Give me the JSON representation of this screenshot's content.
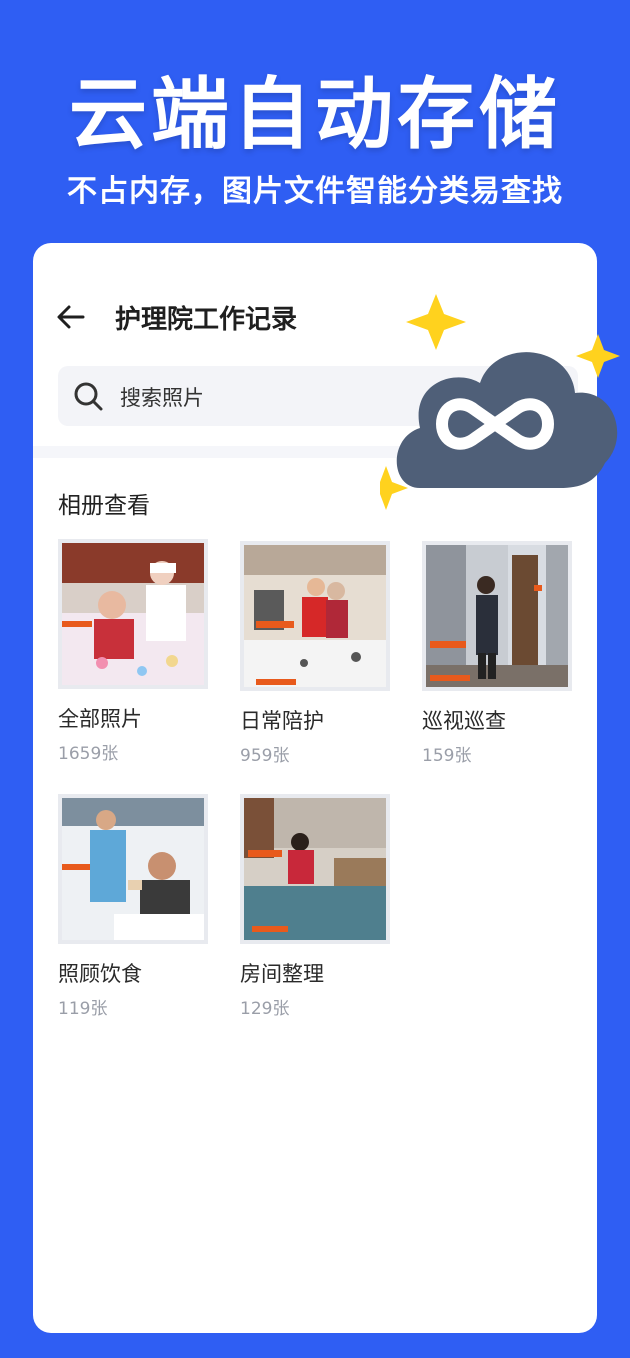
{
  "hero": {
    "title": "云端自动存储",
    "subtitle": "不占内存，图片文件智能分类易查找"
  },
  "header": {
    "back_icon": "arrow-left-icon",
    "title": "护理院工作记录"
  },
  "search": {
    "icon": "search-icon",
    "placeholder": "搜索照片"
  },
  "section": {
    "title": "相册查看"
  },
  "albums": [
    {
      "name": "全部照片",
      "count": "1659张"
    },
    {
      "name": "日常陪护",
      "count": "959张"
    },
    {
      "name": "巡视巡查",
      "count": "159张"
    },
    {
      "name": "照顾饮食",
      "count": "119张"
    },
    {
      "name": "房间整理",
      "count": "129张"
    }
  ],
  "badge": {
    "icon": "cloud-infinity-icon",
    "sparkle_icon": "sparkle-icon"
  },
  "colors": {
    "background": "#2f5ef3",
    "cloud": "#4f5f78",
    "sparkle": "#ffd21e"
  }
}
